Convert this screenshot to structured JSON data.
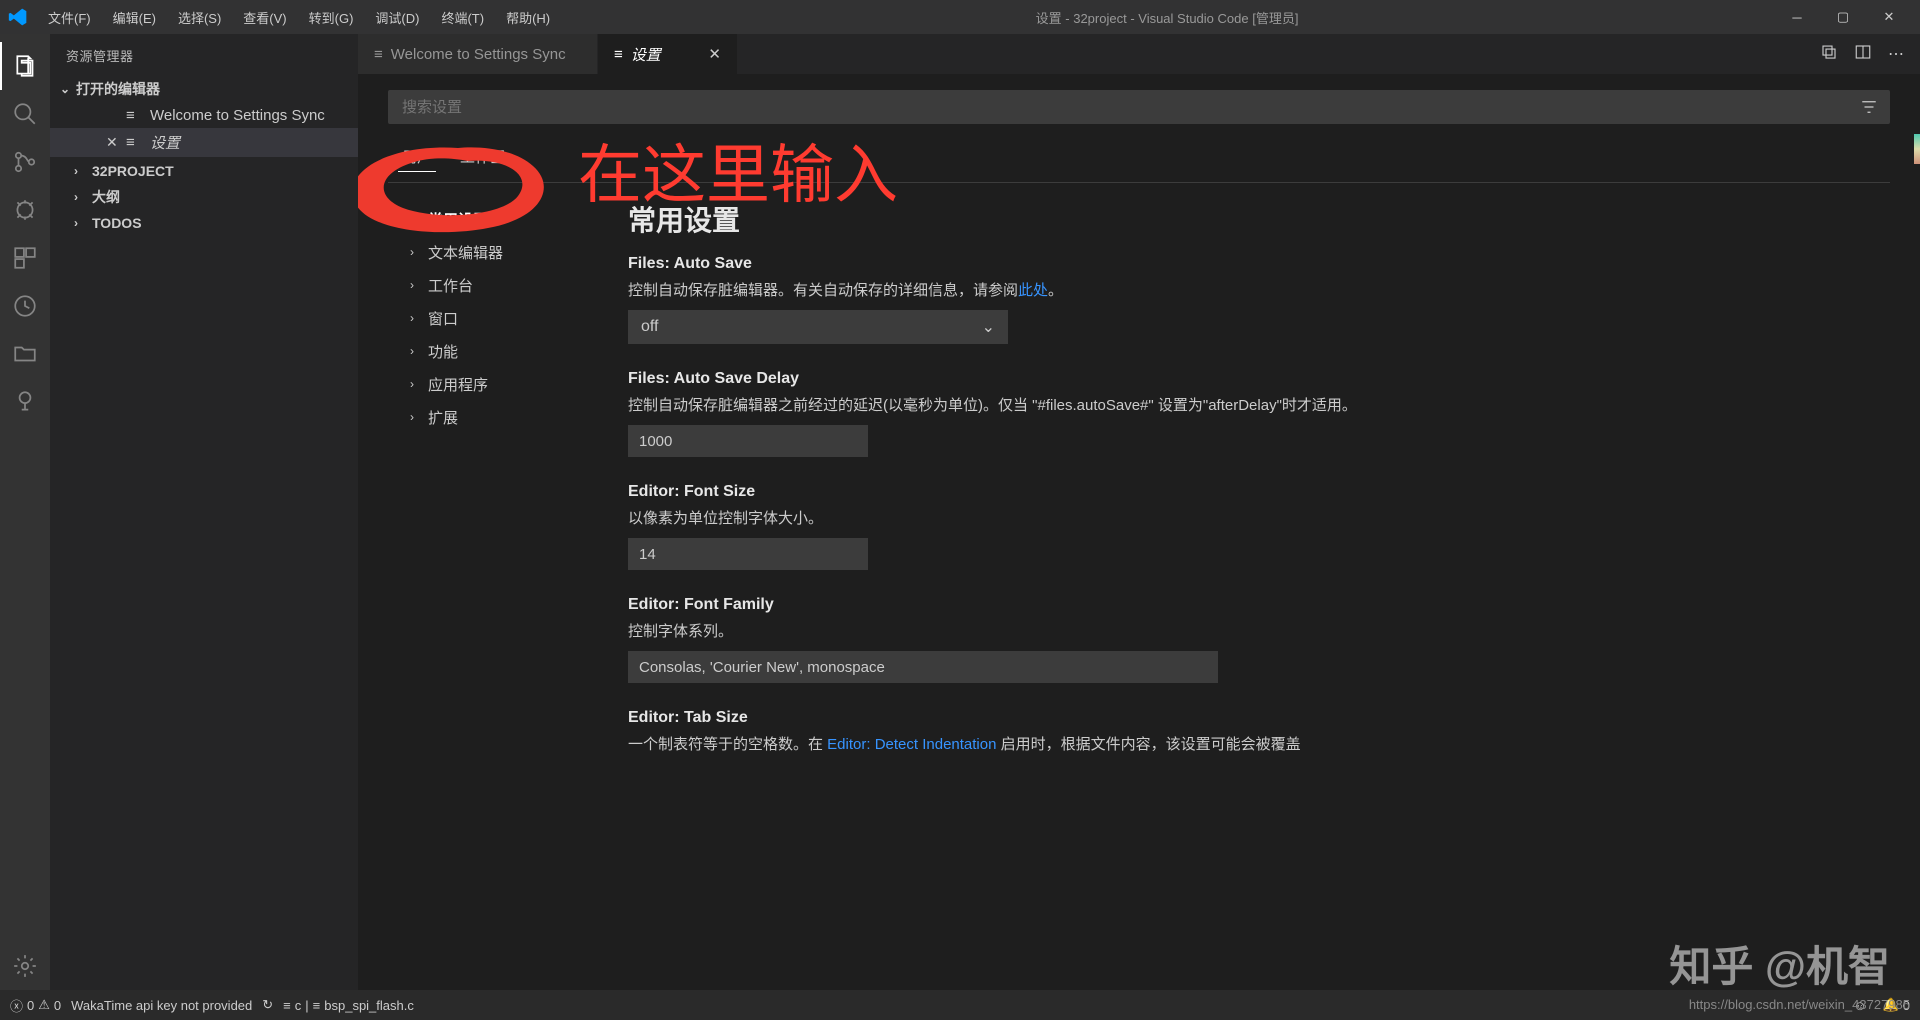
{
  "titlebar": {
    "menus": [
      "文件(F)",
      "编辑(E)",
      "选择(S)",
      "查看(V)",
      "转到(G)",
      "调试(D)",
      "终端(T)",
      "帮助(H)"
    ],
    "title": "设置 - 32project - Visual Studio Code [管理员]"
  },
  "sidebar": {
    "header": "资源管理器",
    "open_editors_title": "打开的编辑器",
    "editors": [
      {
        "label": "Welcome to Settings Sync",
        "selected": false,
        "closeable": false
      },
      {
        "label": "设置",
        "selected": true,
        "closeable": true
      }
    ],
    "sections": [
      {
        "label": "32PROJECT",
        "open": false
      },
      {
        "label": "大纲",
        "open": false
      },
      {
        "label": "TODOS",
        "open": false
      }
    ]
  },
  "tabs": {
    "items": [
      {
        "label": "Welcome to Settings Sync",
        "active": false
      },
      {
        "label": "设置",
        "active": true
      }
    ]
  },
  "settings": {
    "search_placeholder": "搜索设置",
    "scopes": [
      "用户",
      "工作区"
    ],
    "nav": [
      {
        "label": "常用设置",
        "bold": true
      },
      {
        "label": "文本编辑器",
        "chev": true
      },
      {
        "label": "工作台",
        "chev": true
      },
      {
        "label": "窗口",
        "chev": true
      },
      {
        "label": "功能",
        "chev": true
      },
      {
        "label": "应用程序",
        "chev": true
      },
      {
        "label": "扩展",
        "chev": true
      }
    ],
    "heading": "常用设置",
    "blocks": [
      {
        "title": "Files: Auto Save",
        "desc_pre": "控制自动保存脏编辑器。有关自动保存的详细信息，请参阅",
        "link": "此处",
        "desc_post": "。",
        "type": "select",
        "value": "off"
      },
      {
        "title": "Files: Auto Save Delay",
        "desc_pre": "控制自动保存脏编辑器之前经过的延迟(以毫秒为单位)。仅当 \"#files.autoSave#\" 设置为\"afterDelay\"时才适用。",
        "type": "input",
        "value": "1000"
      },
      {
        "title": "Editor: Font Size",
        "desc_pre": "以像素为单位控制字体大小。",
        "type": "input",
        "value": "14"
      },
      {
        "title": "Editor: Font Family",
        "desc_pre": "控制字体系列。",
        "type": "input-wide",
        "value": "Consolas, 'Courier New', monospace"
      },
      {
        "title": "Editor: Tab Size",
        "desc_pre": "一个制表符等于的空格数。在 ",
        "link": "Editor: Detect Indentation",
        "desc_post": " 启用时，根据文件内容，该设置可能会被覆盖",
        "type": "cut"
      }
    ]
  },
  "statusbar": {
    "errors": "0",
    "warnings": "0",
    "wakatime": "WakaTime api key not provided",
    "lang": "c",
    "file": "bsp_spi_flash.c",
    "bell": "0"
  },
  "annotation": {
    "red_text": "在这里输入"
  },
  "watermark": {
    "zhihu": "知乎 @机智",
    "url": "https://blog.csdn.net/weixin_43727985"
  }
}
